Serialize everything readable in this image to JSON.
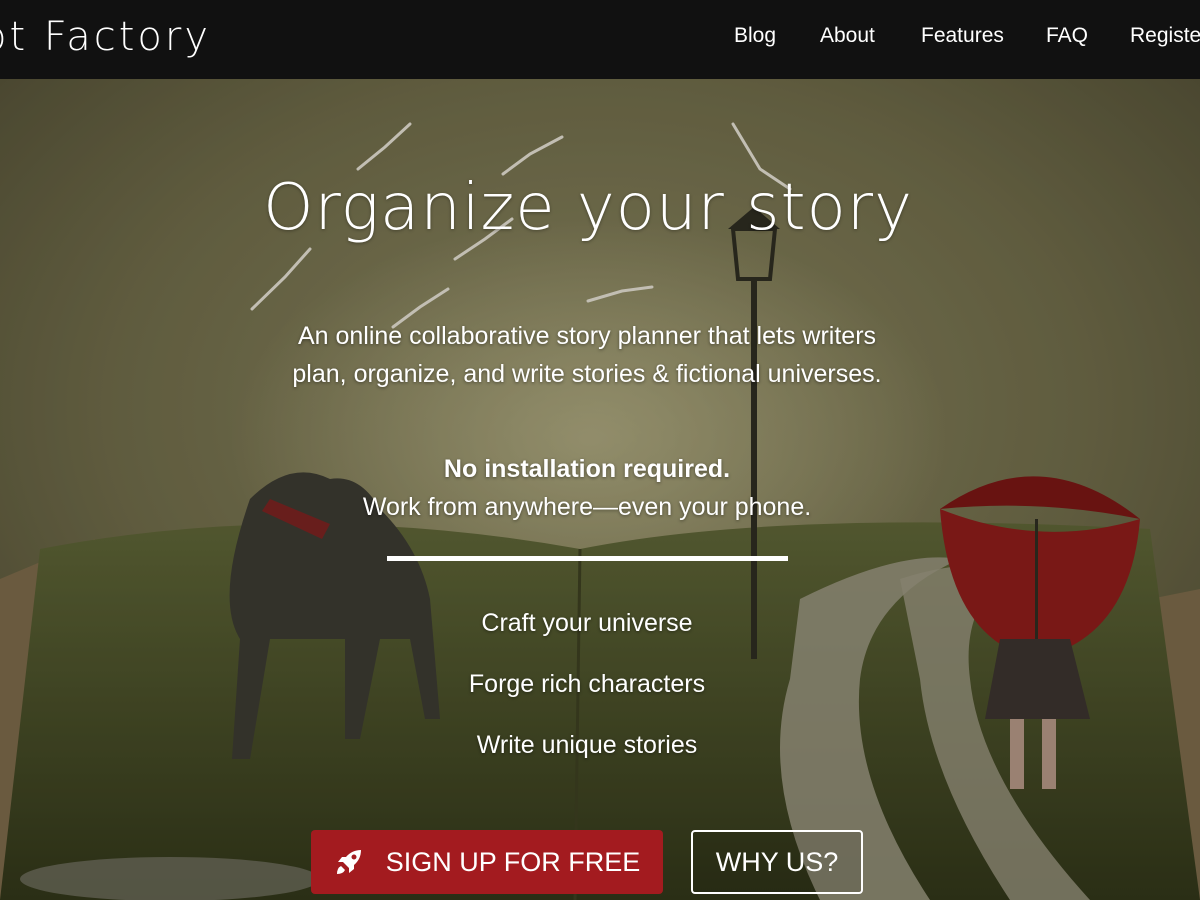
{
  "nav": {
    "brand": "Notebook.ai Plot Factory",
    "brand_visible": "ot Factory",
    "links": [
      "Blog",
      "About",
      "Features",
      "FAQ",
      "Register"
    ]
  },
  "hero": {
    "title": "Organize your story",
    "description": "An online collaborative story planner that lets writers plan, organize, and write stories & fictional universes.",
    "strong": "No installation required.",
    "sub": "Work from anywhere—even your phone.",
    "features": [
      "Craft your universe",
      "Forge rich characters",
      "Write unique stories"
    ],
    "signup_label": "SIGN UP FOR FREE",
    "signup_icon": "rocket-icon",
    "why_label": "WHY US?"
  },
  "colors": {
    "nav_bg": "#111111",
    "signup_bg": "#a31b1f",
    "text": "#ffffff"
  }
}
